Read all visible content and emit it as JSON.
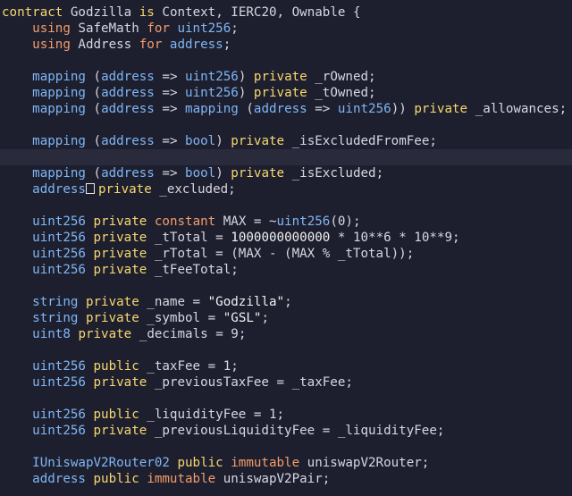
{
  "lines": [
    [
      {
        "c": "kw",
        "t": "contract"
      },
      {
        "c": "id",
        "t": " Godzilla "
      },
      {
        "c": "kw",
        "t": "is"
      },
      {
        "c": "id",
        "t": " Context, IERC20, Ownable {"
      }
    ],
    [
      {
        "c": "id",
        "t": "    "
      },
      {
        "c": "kw2",
        "t": "using"
      },
      {
        "c": "id",
        "t": " SafeMath "
      },
      {
        "c": "kw2",
        "t": "for"
      },
      {
        "c": "ty",
        "t": " uint256"
      },
      {
        "c": "id",
        "t": ";"
      }
    ],
    [
      {
        "c": "id",
        "t": "    "
      },
      {
        "c": "kw2",
        "t": "using"
      },
      {
        "c": "id",
        "t": " Address "
      },
      {
        "c": "kw2",
        "t": "for"
      },
      {
        "c": "ty",
        "t": " address"
      },
      {
        "c": "id",
        "t": ";"
      }
    ],
    [],
    [
      {
        "c": "id",
        "t": "    "
      },
      {
        "c": "ty",
        "t": "mapping"
      },
      {
        "c": "id",
        "t": " ("
      },
      {
        "c": "ty",
        "t": "address"
      },
      {
        "c": "id",
        "t": " => "
      },
      {
        "c": "ty",
        "t": "uint256"
      },
      {
        "c": "id",
        "t": ") "
      },
      {
        "c": "kw",
        "t": "private"
      },
      {
        "c": "id",
        "t": " _rOwned;"
      }
    ],
    [
      {
        "c": "id",
        "t": "    "
      },
      {
        "c": "ty",
        "t": "mapping"
      },
      {
        "c": "id",
        "t": " ("
      },
      {
        "c": "ty",
        "t": "address"
      },
      {
        "c": "id",
        "t": " => "
      },
      {
        "c": "ty",
        "t": "uint256"
      },
      {
        "c": "id",
        "t": ") "
      },
      {
        "c": "kw",
        "t": "private"
      },
      {
        "c": "id",
        "t": " _tOwned;"
      }
    ],
    [
      {
        "c": "id",
        "t": "    "
      },
      {
        "c": "ty",
        "t": "mapping"
      },
      {
        "c": "id",
        "t": " ("
      },
      {
        "c": "ty",
        "t": "address"
      },
      {
        "c": "id",
        "t": " => "
      },
      {
        "c": "ty",
        "t": "mapping"
      },
      {
        "c": "id",
        "t": " ("
      },
      {
        "c": "ty",
        "t": "address"
      },
      {
        "c": "id",
        "t": " => "
      },
      {
        "c": "ty",
        "t": "uint256"
      },
      {
        "c": "id",
        "t": ")) "
      },
      {
        "c": "kw",
        "t": "private"
      },
      {
        "c": "id",
        "t": " _allowances;"
      }
    ],
    [],
    [
      {
        "c": "id",
        "t": "    "
      },
      {
        "c": "ty",
        "t": "mapping"
      },
      {
        "c": "id",
        "t": " ("
      },
      {
        "c": "ty",
        "t": "address"
      },
      {
        "c": "id",
        "t": " => "
      },
      {
        "c": "ty",
        "t": "bool"
      },
      {
        "c": "id",
        "t": ") "
      },
      {
        "c": "kw",
        "t": "private"
      },
      {
        "c": "id",
        "t": " _isExcludedFromFee;"
      }
    ],
    [],
    [
      {
        "c": "id",
        "t": "    "
      },
      {
        "c": "ty",
        "t": "mapping"
      },
      {
        "c": "id",
        "t": " ("
      },
      {
        "c": "ty",
        "t": "address"
      },
      {
        "c": "id",
        "t": " => "
      },
      {
        "c": "ty",
        "t": "bool"
      },
      {
        "c": "id",
        "t": ") "
      },
      {
        "c": "kw",
        "t": "private"
      },
      {
        "c": "id",
        "t": " _isExcluded;"
      }
    ],
    [
      {
        "c": "id",
        "t": "    "
      },
      {
        "c": "ty",
        "t": "address"
      },
      {
        "c": "arr",
        "t": ""
      },
      {
        "c": "kw",
        "t": "private"
      },
      {
        "c": "id",
        "t": " _excluded;"
      }
    ],
    [],
    [
      {
        "c": "id",
        "t": "    "
      },
      {
        "c": "ty",
        "t": "uint256"
      },
      {
        "c": "id",
        "t": " "
      },
      {
        "c": "kw",
        "t": "private"
      },
      {
        "c": "id",
        "t": " "
      },
      {
        "c": "kw2",
        "t": "constant"
      },
      {
        "c": "id",
        "t": " MAX = ~"
      },
      {
        "c": "ty",
        "t": "uint256"
      },
      {
        "c": "id",
        "t": "(0);"
      }
    ],
    [
      {
        "c": "id",
        "t": "    "
      },
      {
        "c": "ty",
        "t": "uint256"
      },
      {
        "c": "id",
        "t": " "
      },
      {
        "c": "kw",
        "t": "private"
      },
      {
        "c": "id",
        "t": " _tTotal = "
      },
      {
        "c": "num",
        "t": "1000000000000"
      },
      {
        "c": "id",
        "t": " * 10**6 * 10**9;"
      }
    ],
    [
      {
        "c": "id",
        "t": "    "
      },
      {
        "c": "ty",
        "t": "uint256"
      },
      {
        "c": "id",
        "t": " "
      },
      {
        "c": "kw",
        "t": "private"
      },
      {
        "c": "id",
        "t": " _rTotal = (MAX - (MAX % _tTotal));"
      }
    ],
    [
      {
        "c": "id",
        "t": "    "
      },
      {
        "c": "ty",
        "t": "uint256"
      },
      {
        "c": "id",
        "t": " "
      },
      {
        "c": "kw",
        "t": "private"
      },
      {
        "c": "id",
        "t": " _tFeeTotal;"
      }
    ],
    [],
    [
      {
        "c": "id",
        "t": "    "
      },
      {
        "c": "ty",
        "t": "string"
      },
      {
        "c": "id",
        "t": " "
      },
      {
        "c": "kw",
        "t": "private"
      },
      {
        "c": "id",
        "t": " _name = "
      },
      {
        "c": "str",
        "t": "\"Godzilla\""
      },
      {
        "c": "id",
        "t": ";"
      }
    ],
    [
      {
        "c": "id",
        "t": "    "
      },
      {
        "c": "ty",
        "t": "string"
      },
      {
        "c": "id",
        "t": " "
      },
      {
        "c": "kw",
        "t": "private"
      },
      {
        "c": "id",
        "t": " _symbol = "
      },
      {
        "c": "str",
        "t": "\"GSL\""
      },
      {
        "c": "id",
        "t": ";"
      }
    ],
    [
      {
        "c": "id",
        "t": "    "
      },
      {
        "c": "ty",
        "t": "uint8"
      },
      {
        "c": "id",
        "t": " "
      },
      {
        "c": "kw",
        "t": "private"
      },
      {
        "c": "id",
        "t": " _decimals = 9;"
      }
    ],
    [],
    [
      {
        "c": "id",
        "t": "    "
      },
      {
        "c": "ty",
        "t": "uint256"
      },
      {
        "c": "id",
        "t": " "
      },
      {
        "c": "kw",
        "t": "public"
      },
      {
        "c": "id",
        "t": " _taxFee = 1;"
      }
    ],
    [
      {
        "c": "id",
        "t": "    "
      },
      {
        "c": "ty",
        "t": "uint256"
      },
      {
        "c": "id",
        "t": " "
      },
      {
        "c": "kw",
        "t": "private"
      },
      {
        "c": "id",
        "t": " _previousTaxFee = _taxFee;"
      }
    ],
    [],
    [
      {
        "c": "id",
        "t": "    "
      },
      {
        "c": "ty",
        "t": "uint256"
      },
      {
        "c": "id",
        "t": " "
      },
      {
        "c": "kw",
        "t": "public"
      },
      {
        "c": "id",
        "t": " _liquidityFee = 1;"
      }
    ],
    [
      {
        "c": "id",
        "t": "    "
      },
      {
        "c": "ty",
        "t": "uint256"
      },
      {
        "c": "id",
        "t": " "
      },
      {
        "c": "kw",
        "t": "private"
      },
      {
        "c": "id",
        "t": " _previousLiquidityFee = _liquidityFee;"
      }
    ],
    [],
    [
      {
        "c": "id",
        "t": "    "
      },
      {
        "c": "ty",
        "t": "IUniswapV2Router02"
      },
      {
        "c": "id",
        "t": " "
      },
      {
        "c": "kw",
        "t": "public"
      },
      {
        "c": "id",
        "t": " "
      },
      {
        "c": "kw2",
        "t": "immutable"
      },
      {
        "c": "id",
        "t": " uniswapV2Router;"
      }
    ],
    [
      {
        "c": "id",
        "t": "    "
      },
      {
        "c": "ty",
        "t": "address"
      },
      {
        "c": "id",
        "t": " "
      },
      {
        "c": "kw",
        "t": "public"
      },
      {
        "c": "id",
        "t": " "
      },
      {
        "c": "kw2",
        "t": "immutable"
      },
      {
        "c": "id",
        "t": " uniswapV2Pair;"
      }
    ]
  ],
  "current_line": 9
}
